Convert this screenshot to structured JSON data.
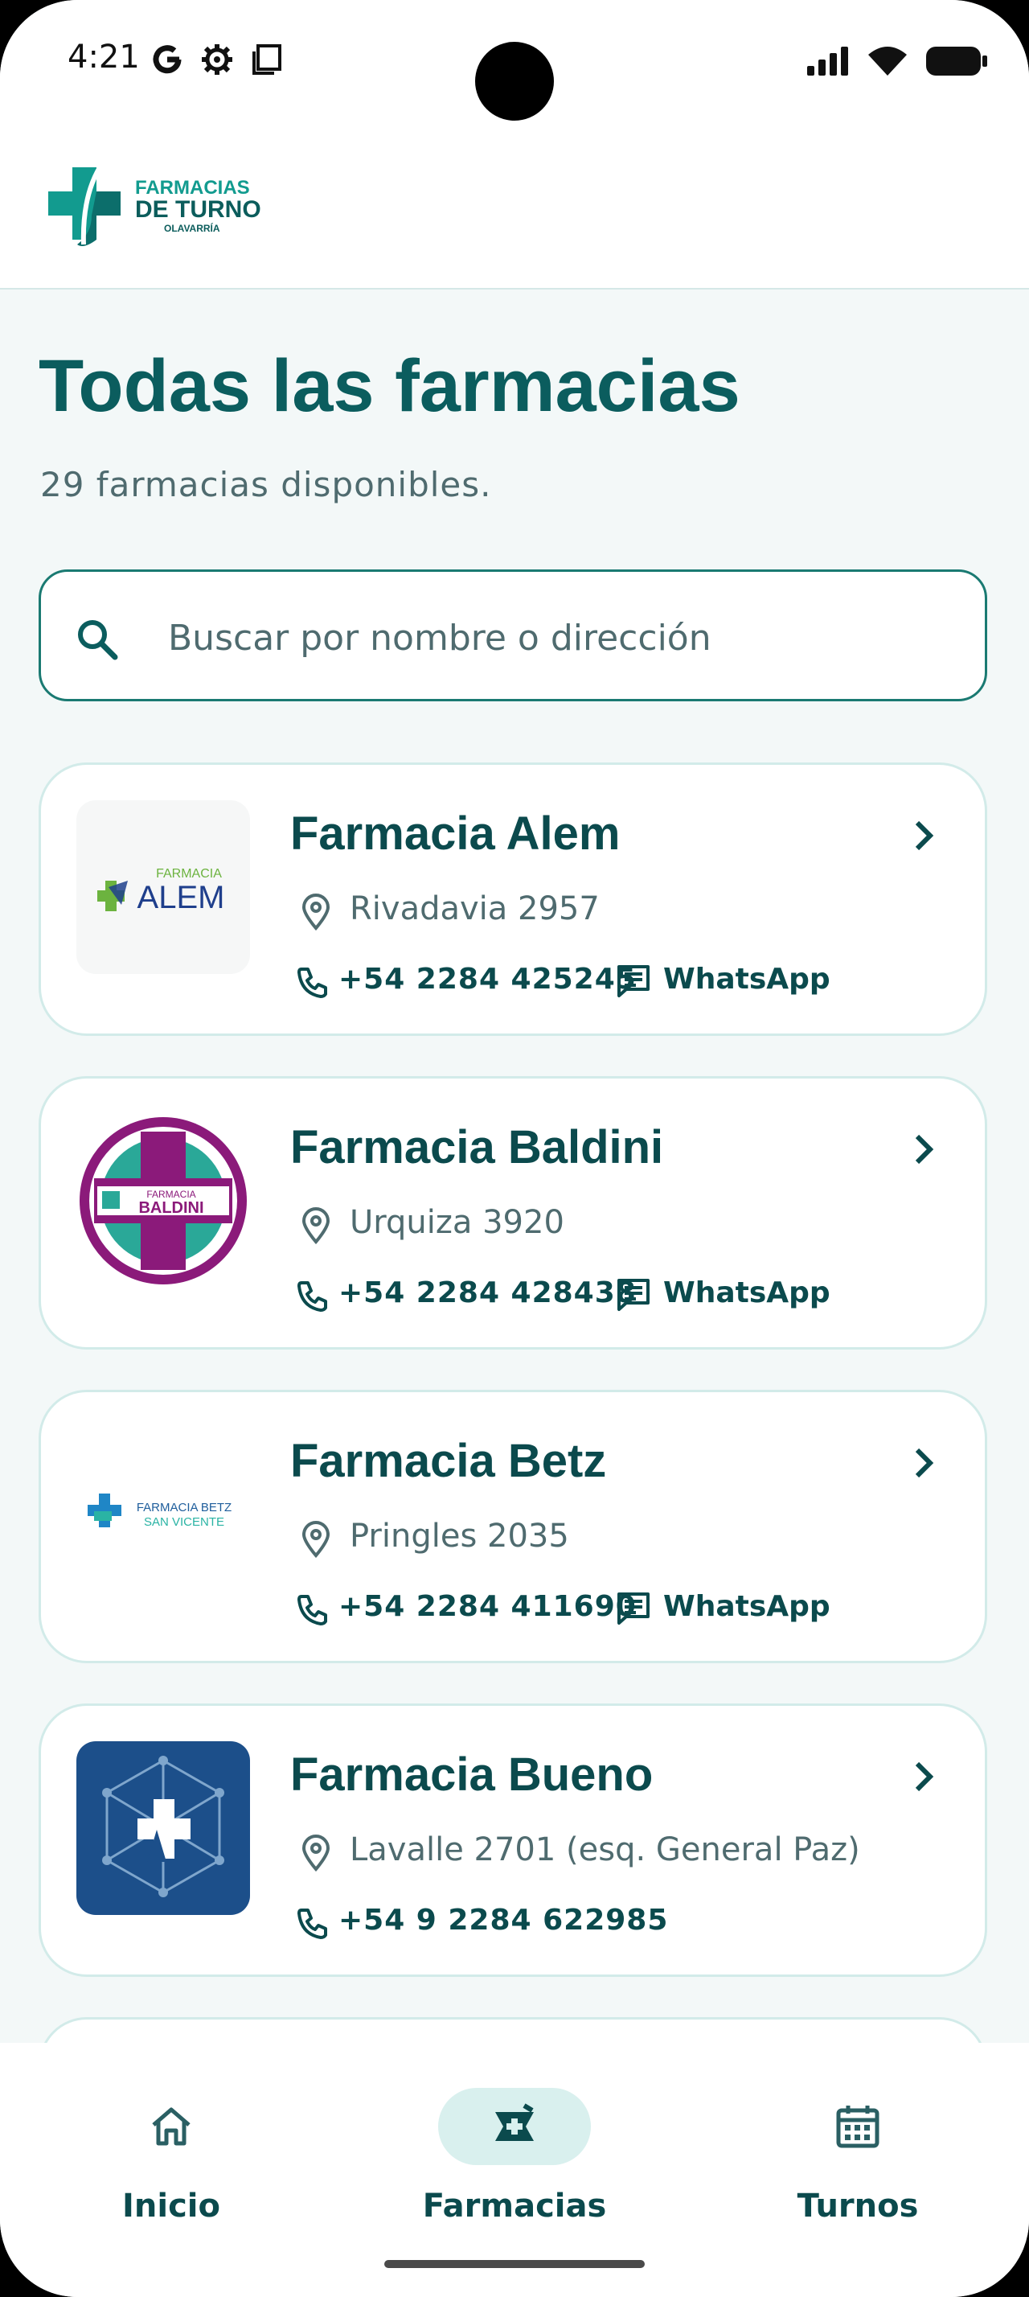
{
  "status": {
    "time": "4:21"
  },
  "logo": {
    "line1": "FARMACIAS",
    "line2": "DE TURNO",
    "line3": "OLAVARRÍA"
  },
  "page": {
    "title": "Todas las farmacias",
    "subtitle": "29 farmacias disponibles."
  },
  "search": {
    "placeholder": "Buscar por nombre o dirección",
    "value": ""
  },
  "pharmacies": [
    {
      "name": "Farmacia Alem",
      "address": "Rivadavia 2957",
      "phone": "+54 2284 425245",
      "whatsapp": "WhatsApp",
      "logo_text": "FARMACIA",
      "logo_text2": "ALEM"
    },
    {
      "name": "Farmacia Baldini",
      "address": "Urquiza 3920",
      "phone": "+54 2284 428438",
      "whatsapp": "WhatsApp",
      "logo_text": "FARMACIA",
      "logo_text2": "BALDINI"
    },
    {
      "name": "Farmacia Betz",
      "address": "Pringles 2035",
      "phone": "+54 2284 411690",
      "whatsapp": "WhatsApp",
      "logo_text": "FARMACIA BETZ",
      "logo_text2": "SAN VICENTE"
    },
    {
      "name": "Farmacia Bueno",
      "address": "Lavalle 2701 (esq. General Paz)",
      "phone": "+54 9 2284 622985"
    }
  ],
  "nav": [
    {
      "label": "Inicio",
      "icon": "home-icon",
      "active": false
    },
    {
      "label": "Farmacias",
      "icon": "pharmacy-icon",
      "active": true
    },
    {
      "label": "Turnos",
      "icon": "calendar-icon",
      "active": false
    }
  ],
  "colors": {
    "primary": "#0b5d5e",
    "accent": "#129b8f",
    "background": "#f3f8f8",
    "nav_active": "#d9f0ee"
  }
}
